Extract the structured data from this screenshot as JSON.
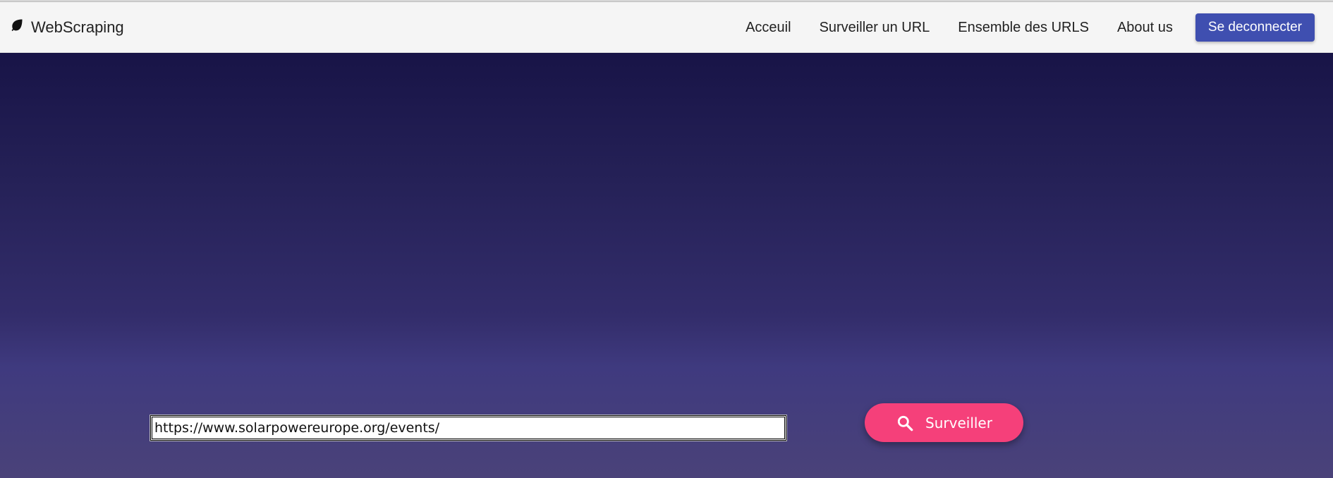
{
  "navbar": {
    "brand": "WebScraping",
    "brand_icon": "leaf-icon",
    "links": [
      {
        "label": "Acceuil"
      },
      {
        "label": "Surveiller un URL"
      },
      {
        "label": "Ensemble des URLS"
      },
      {
        "label": "About us"
      }
    ],
    "logout_label": "Se deconnecter"
  },
  "main": {
    "url_value": "https://www.solarpowereurope.org/events/",
    "submit_label": "Surveiller",
    "submit_icon": "search-icon"
  },
  "colors": {
    "navbar_bg": "#f5f5f5",
    "logout_button": "#3f4fb0",
    "hero_top": "#181447",
    "hero_bottom": "#4a4279",
    "submit_button": "#f5407a"
  }
}
